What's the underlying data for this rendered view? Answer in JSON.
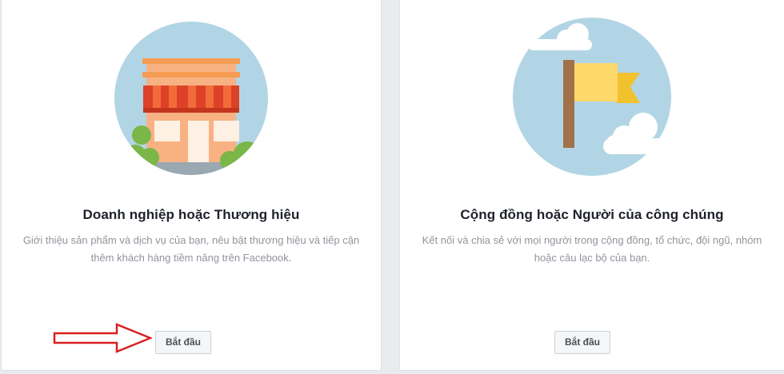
{
  "cards": [
    {
      "title": "Doanh nghiệp hoặc Thương hiệu",
      "description": "Giới thiệu sản phẩm và dịch vụ của bạn, nêu bật thương hiệu và tiếp cận thêm khách hàng tiềm năng trên Facebook.",
      "button_label": "Bắt đầu",
      "illustration": "storefront-icon"
    },
    {
      "title": "Cộng đồng hoặc Người của công chúng",
      "description": "Kết nối và chia sẻ với mọi người trong cộng đồng, tổ chức, đội ngũ, nhóm hoặc câu lạc bộ của bạn.",
      "button_label": "Bắt đầu",
      "illustration": "flag-icon"
    }
  ],
  "annotation": {
    "arrow_icon": "red-outline-arrow-icon",
    "arrow_color": "#d9201f"
  },
  "colors": {
    "page_background": "#e9ebee",
    "card_background": "#ffffff",
    "title_text": "#1d2129",
    "description_text": "#90949c",
    "illustration_circle": "#b2d5e5",
    "button_background": "#f5f6f7"
  }
}
